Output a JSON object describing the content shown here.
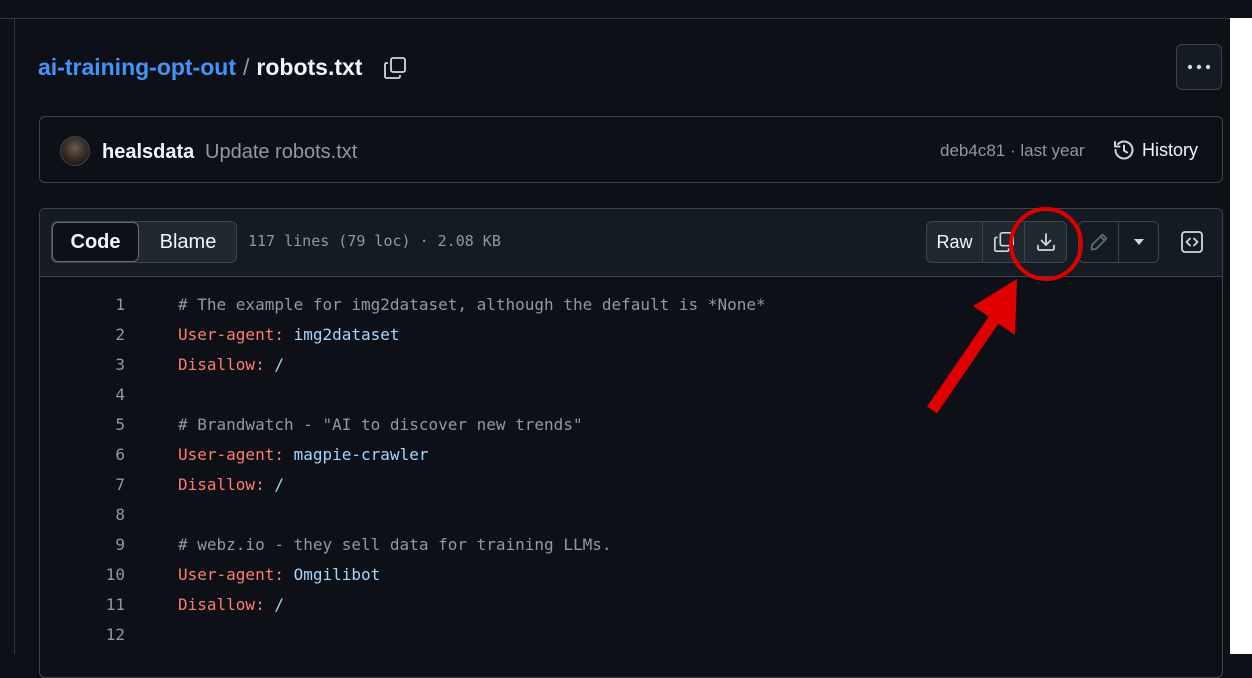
{
  "breadcrumb": {
    "repo": "ai-training-opt-out",
    "separator": "/",
    "file": "robots.txt"
  },
  "icons": {
    "copy_path": "copy-icon",
    "more": "kebab-horizontal-icon",
    "history": "history-icon",
    "copy_raw": "copy-icon",
    "download": "download-icon",
    "edit": "pencil-icon",
    "caret": "triangle-down-icon",
    "symbols": "code-square-icon"
  },
  "commit": {
    "author": "healsdata",
    "message": "Update robots.txt",
    "meta": "deb4c81 · last year",
    "history_label": "History"
  },
  "file_header": {
    "tabs": [
      "Code",
      "Blame"
    ],
    "active_tab": "Code",
    "info": "117 lines (79 loc) · 2.08 KB",
    "raw_label": "Raw"
  },
  "code_lines": [
    {
      "num": "1",
      "comment": "# The example for img2dataset, although the default is *None*",
      "key": "",
      "val": ""
    },
    {
      "num": "2",
      "comment": "",
      "key": "User-agent:",
      "val": " img2dataset"
    },
    {
      "num": "3",
      "comment": "",
      "key": "Disallow:",
      "val": " /"
    },
    {
      "num": "4",
      "comment": "",
      "key": "",
      "val": ""
    },
    {
      "num": "5",
      "comment": "# Brandwatch - \"AI to discover new trends\"",
      "key": "",
      "val": ""
    },
    {
      "num": "6",
      "comment": "",
      "key": "User-agent:",
      "val": " magpie-crawler"
    },
    {
      "num": "7",
      "comment": "",
      "key": "Disallow:",
      "val": " /"
    },
    {
      "num": "8",
      "comment": "",
      "key": "",
      "val": ""
    },
    {
      "num": "9",
      "comment": "# webz.io - they sell data for training LLMs.",
      "key": "",
      "val": ""
    },
    {
      "num": "10",
      "comment": "",
      "key": "User-agent:",
      "val": " Omgilibot"
    },
    {
      "num": "11",
      "comment": "",
      "key": "Disallow:",
      "val": " /"
    },
    {
      "num": "12",
      "comment": "",
      "key": "",
      "val": ""
    }
  ],
  "colors": {
    "background": "#0d1117",
    "link": "#4493f8",
    "keyword": "#ff7b72",
    "value": "#a5d6ff",
    "annotation": "#e00000"
  }
}
